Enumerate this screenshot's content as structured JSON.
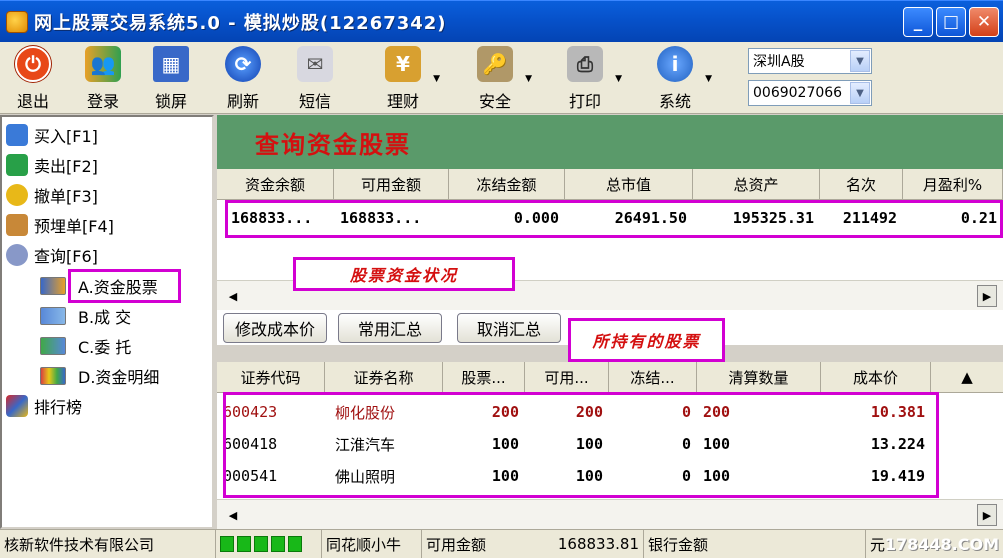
{
  "window": {
    "title": "网上股票交易系统5.0 - 模拟炒股(12267342)",
    "min": "_",
    "max": "□",
    "close": "✕"
  },
  "toolbar": {
    "buttons": [
      {
        "label": "退出",
        "icon": "exit-icon",
        "color": "#e84818"
      },
      {
        "label": "登录",
        "icon": "login-icon",
        "color": "#e8a028"
      },
      {
        "label": "锁屏",
        "icon": "lock-screen-icon",
        "color": "#3868c8"
      },
      {
        "label": "刷新",
        "icon": "refresh-icon",
        "color": "#1858c8"
      },
      {
        "label": "短信",
        "icon": "message-icon",
        "color": "#b8b8c8"
      },
      {
        "label": "理财",
        "icon": "finance-icon",
        "color": "#d8a030"
      },
      {
        "label": "安全",
        "icon": "security-icon",
        "color": "#a08858"
      },
      {
        "label": "打印",
        "icon": "print-icon",
        "color": "#a8a8a8"
      },
      {
        "label": "系统",
        "icon": "system-info-icon",
        "color": "#3070d0"
      }
    ],
    "market_select": "深圳A股",
    "account_select": "0069027066"
  },
  "sidebar": {
    "items": [
      {
        "label": "买入[F1]",
        "color": "#3a7ad8"
      },
      {
        "label": "卖出[F2]",
        "color": "#28a048"
      },
      {
        "label": "撤单[F3]",
        "color": "#e8b818"
      },
      {
        "label": "预埋单[F4]",
        "color": "#c88838"
      },
      {
        "label": "查询[F6]",
        "color": "#8898c8"
      }
    ],
    "sub_items": [
      {
        "label": "A.资金股票"
      },
      {
        "label": "B.成  交"
      },
      {
        "label": "C.委  托"
      },
      {
        "label": "D.资金明细"
      }
    ],
    "rank": "排行榜"
  },
  "panel": {
    "title": "查询资金股票",
    "fund_headers": [
      "资金余额",
      "可用金额",
      "冻结金额",
      "总市值",
      "总资产",
      "名次",
      "月盈利%"
    ],
    "fund_row": [
      "168833...",
      "168833...",
      "0.000",
      "26491.50",
      "195325.31",
      "211492",
      "0.21"
    ],
    "annot_fund": "股票资金状况",
    "buttons": {
      "edit_cost": "修改成本价",
      "summary": "常用汇总",
      "cancel_summary": "取消汇总"
    },
    "annot_holdings": "所持有的股票",
    "stock_headers": [
      "证券代码",
      "证券名称",
      "股票...",
      "可用...",
      "冻结...",
      "清算数量",
      "成本价"
    ],
    "stocks": [
      {
        "code": "600423",
        "name": "柳化股份",
        "qty": "200",
        "avail": "200",
        "frozen": "0",
        "settle": "200",
        "cost": "10.381",
        "color": "#a01010"
      },
      {
        "code": "600418",
        "name": "江淮汽车",
        "qty": "100",
        "avail": "100",
        "frozen": "0",
        "settle": "100",
        "cost": "13.224",
        "color": "#000000"
      },
      {
        "code": "000541",
        "name": "佛山照明",
        "qty": "100",
        "avail": "100",
        "frozen": "0",
        "settle": "100",
        "cost": "19.419",
        "color": "#000000"
      }
    ]
  },
  "status": {
    "company": "核新软件技术有限公司",
    "app": "同花顺小牛",
    "avail_label": "可用金额",
    "avail_value": "168833.81",
    "bank_label": "银行金额",
    "unit": "元",
    "watermark": "178448.COM"
  }
}
